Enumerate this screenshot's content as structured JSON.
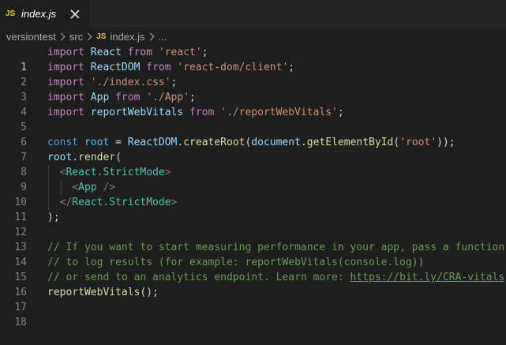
{
  "tab": {
    "badge": "JS",
    "title": "index.js"
  },
  "breadcrumb": {
    "items": [
      "versiontest",
      "src"
    ],
    "file_badge": "JS",
    "file": "index.js",
    "more": "..."
  },
  "editor": {
    "current_line": 1,
    "line_numbers": [
      "1",
      "2",
      "3",
      "4",
      "5",
      "6",
      "7",
      "8",
      "9",
      "10",
      "11",
      "12",
      "13",
      "14",
      "15",
      "16",
      "17",
      "18"
    ],
    "l1": [
      "import",
      "React",
      "from",
      "'react'",
      ";"
    ],
    "l2": [
      "import",
      "ReactDOM",
      "from",
      "'react-dom/client'",
      ";"
    ],
    "l3": [
      "import",
      "'./index.css'",
      ";"
    ],
    "l4": [
      "import",
      "App",
      "from",
      "'./App'",
      ";"
    ],
    "l5": [
      "import",
      "reportWebVitals",
      "from",
      "'./reportWebVitals'",
      ";"
    ],
    "l7": [
      "const",
      "root",
      " = ",
      "ReactDOM",
      ".",
      "createRoot",
      "(",
      "document",
      ".",
      "getElementById",
      "(",
      "'root'",
      "));"
    ],
    "l8": [
      "root",
      ".",
      "render",
      "("
    ],
    "l9": [
      "<",
      "React.StrictMode",
      ">"
    ],
    "l10": [
      "<",
      "App",
      " />"
    ],
    "l11": [
      "</",
      "React.StrictMode",
      ">"
    ],
    "l12": [
      ");"
    ],
    "l14": "// If you want to start measuring performance in your app, pass a function",
    "l15": "// to log results (for example: reportWebVitals(console.log))",
    "l16": [
      "// or send to an analytics endpoint. Learn more: ",
      "https://bit.ly/CRA-vitals"
    ],
    "l17": [
      "reportWebVitals",
      "();"
    ]
  }
}
